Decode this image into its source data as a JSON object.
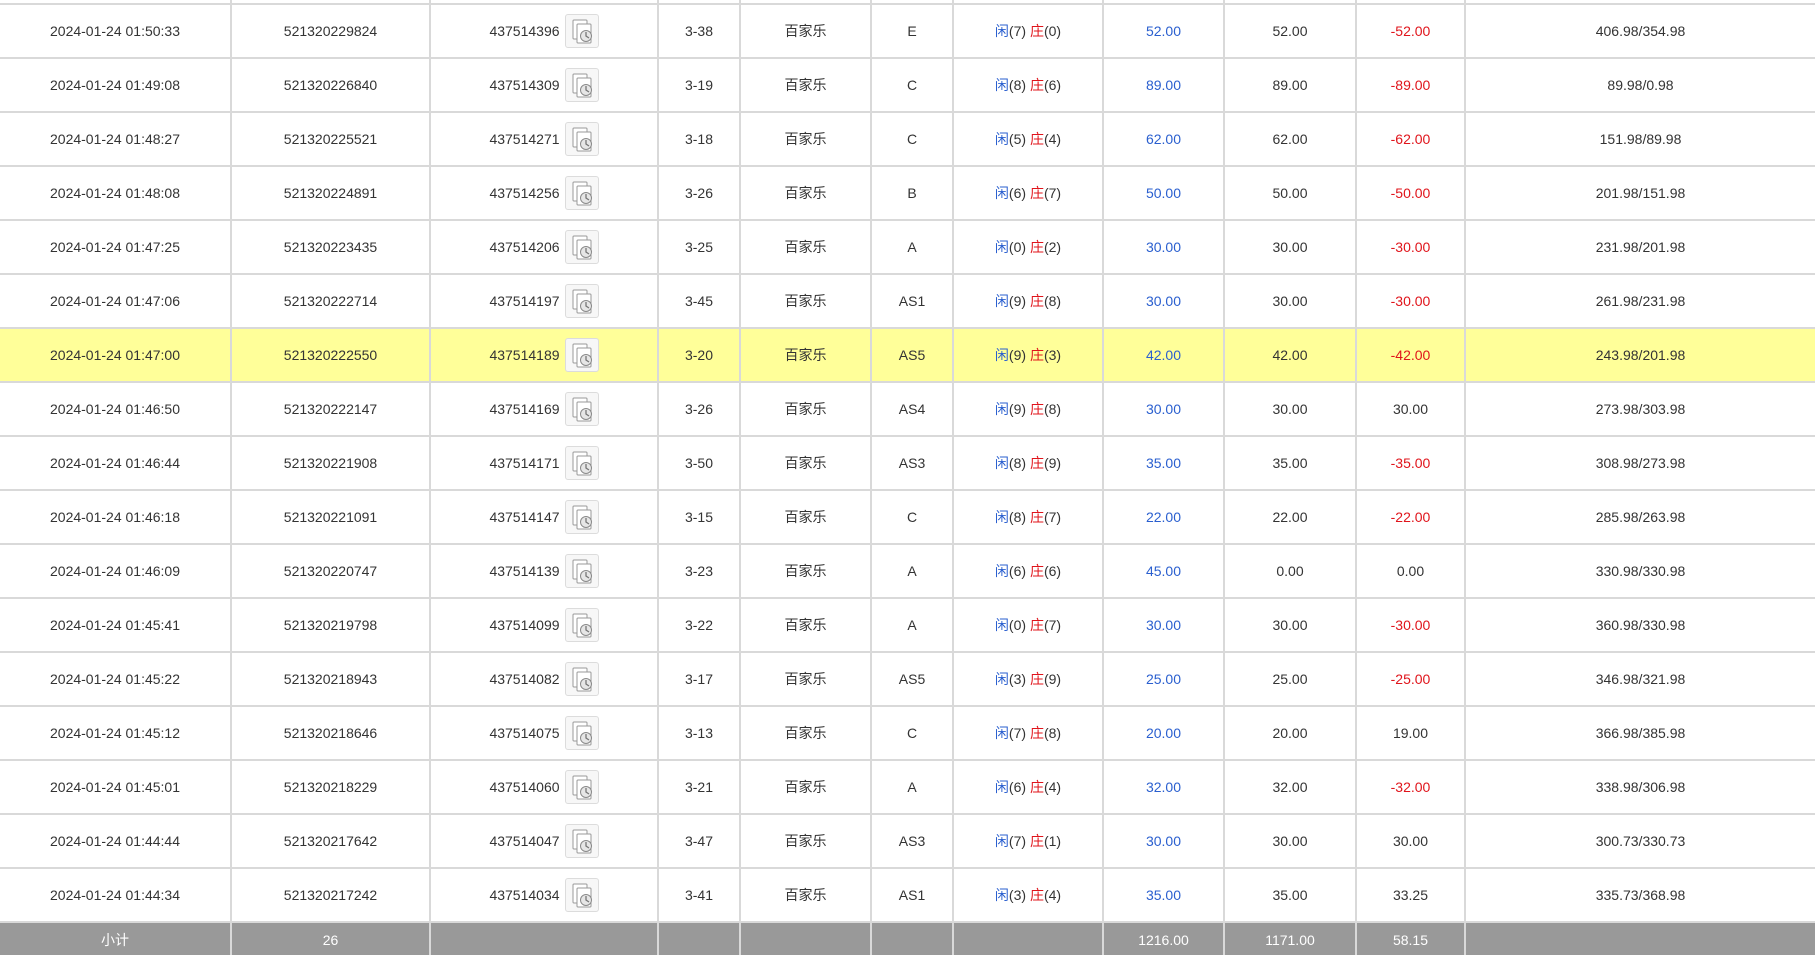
{
  "labels": {
    "player": "闲",
    "banker": "庄"
  },
  "colors": {
    "highlight_row": "#ffff99",
    "bet_amount": "#2a5fcf",
    "negative": "#e0141b",
    "subtotal_bg": "#999999"
  },
  "rows": [
    {
      "time": "2024-01-24 01:50:33",
      "order_id": "521320229824",
      "round_id": "437514396",
      "shoe": "3-38",
      "game": "百家乐",
      "table": "E",
      "player_score": "(7)",
      "banker_score": "(0)",
      "bet": "52.00",
      "valid_bet": "52.00",
      "winloss": "-52.00",
      "balance": "406.98/354.98"
    },
    {
      "time": "2024-01-24 01:49:08",
      "order_id": "521320226840",
      "round_id": "437514309",
      "shoe": "3-19",
      "game": "百家乐",
      "table": "C",
      "player_score": "(8)",
      "banker_score": "(6)",
      "bet": "89.00",
      "valid_bet": "89.00",
      "winloss": "-89.00",
      "balance": "89.98/0.98"
    },
    {
      "time": "2024-01-24 01:48:27",
      "order_id": "521320225521",
      "round_id": "437514271",
      "shoe": "3-18",
      "game": "百家乐",
      "table": "C",
      "player_score": "(5)",
      "banker_score": "(4)",
      "bet": "62.00",
      "valid_bet": "62.00",
      "winloss": "-62.00",
      "balance": "151.98/89.98"
    },
    {
      "time": "2024-01-24 01:48:08",
      "order_id": "521320224891",
      "round_id": "437514256",
      "shoe": "3-26",
      "game": "百家乐",
      "table": "B",
      "player_score": "(6)",
      "banker_score": "(7)",
      "bet": "50.00",
      "valid_bet": "50.00",
      "winloss": "-50.00",
      "balance": "201.98/151.98"
    },
    {
      "time": "2024-01-24 01:47:25",
      "order_id": "521320223435",
      "round_id": "437514206",
      "shoe": "3-25",
      "game": "百家乐",
      "table": "A",
      "player_score": "(0)",
      "banker_score": "(2)",
      "bet": "30.00",
      "valid_bet": "30.00",
      "winloss": "-30.00",
      "balance": "231.98/201.98"
    },
    {
      "time": "2024-01-24 01:47:06",
      "order_id": "521320222714",
      "round_id": "437514197",
      "shoe": "3-45",
      "game": "百家乐",
      "table": "AS1",
      "player_score": "(9)",
      "banker_score": "(8)",
      "bet": "30.00",
      "valid_bet": "30.00",
      "winloss": "-30.00",
      "balance": "261.98/231.98"
    },
    {
      "time": "2024-01-24 01:47:00",
      "order_id": "521320222550",
      "round_id": "437514189",
      "shoe": "3-20",
      "game": "百家乐",
      "table": "AS5",
      "player_score": "(9)",
      "banker_score": "(3)",
      "bet": "42.00",
      "valid_bet": "42.00",
      "winloss": "-42.00",
      "balance": "243.98/201.98",
      "highlight": true
    },
    {
      "time": "2024-01-24 01:46:50",
      "order_id": "521320222147",
      "round_id": "437514169",
      "shoe": "3-26",
      "game": "百家乐",
      "table": "AS4",
      "player_score": "(9)",
      "banker_score": "(8)",
      "bet": "30.00",
      "valid_bet": "30.00",
      "winloss": "30.00",
      "balance": "273.98/303.98"
    },
    {
      "time": "2024-01-24 01:46:44",
      "order_id": "521320221908",
      "round_id": "437514171",
      "shoe": "3-50",
      "game": "百家乐",
      "table": "AS3",
      "player_score": "(8)",
      "banker_score": "(9)",
      "bet": "35.00",
      "valid_bet": "35.00",
      "winloss": "-35.00",
      "balance": "308.98/273.98"
    },
    {
      "time": "2024-01-24 01:46:18",
      "order_id": "521320221091",
      "round_id": "437514147",
      "shoe": "3-15",
      "game": "百家乐",
      "table": "C",
      "player_score": "(8)",
      "banker_score": "(7)",
      "bet": "22.00",
      "valid_bet": "22.00",
      "winloss": "-22.00",
      "balance": "285.98/263.98"
    },
    {
      "time": "2024-01-24 01:46:09",
      "order_id": "521320220747",
      "round_id": "437514139",
      "shoe": "3-23",
      "game": "百家乐",
      "table": "A",
      "player_score": "(6)",
      "banker_score": "(6)",
      "bet": "45.00",
      "valid_bet": "0.00",
      "winloss": "0.00",
      "balance": "330.98/330.98"
    },
    {
      "time": "2024-01-24 01:45:41",
      "order_id": "521320219798",
      "round_id": "437514099",
      "shoe": "3-22",
      "game": "百家乐",
      "table": "A",
      "player_score": "(0)",
      "banker_score": "(7)",
      "bet": "30.00",
      "valid_bet": "30.00",
      "winloss": "-30.00",
      "balance": "360.98/330.98"
    },
    {
      "time": "2024-01-24 01:45:22",
      "order_id": "521320218943",
      "round_id": "437514082",
      "shoe": "3-17",
      "game": "百家乐",
      "table": "AS5",
      "player_score": "(3)",
      "banker_score": "(9)",
      "bet": "25.00",
      "valid_bet": "25.00",
      "winloss": "-25.00",
      "balance": "346.98/321.98"
    },
    {
      "time": "2024-01-24 01:45:12",
      "order_id": "521320218646",
      "round_id": "437514075",
      "shoe": "3-13",
      "game": "百家乐",
      "table": "C",
      "player_score": "(7)",
      "banker_score": "(8)",
      "bet": "20.00",
      "valid_bet": "20.00",
      "winloss": "19.00",
      "balance": "366.98/385.98"
    },
    {
      "time": "2024-01-24 01:45:01",
      "order_id": "521320218229",
      "round_id": "437514060",
      "shoe": "3-21",
      "game": "百家乐",
      "table": "A",
      "player_score": "(6)",
      "banker_score": "(4)",
      "bet": "32.00",
      "valid_bet": "32.00",
      "winloss": "-32.00",
      "balance": "338.98/306.98"
    },
    {
      "time": "2024-01-24 01:44:44",
      "order_id": "521320217642",
      "round_id": "437514047",
      "shoe": "3-47",
      "game": "百家乐",
      "table": "AS3",
      "player_score": "(7)",
      "banker_score": "(1)",
      "bet": "30.00",
      "valid_bet": "30.00",
      "winloss": "30.00",
      "balance": "300.73/330.73"
    },
    {
      "time": "2024-01-24 01:44:34",
      "order_id": "521320217242",
      "round_id": "437514034",
      "shoe": "3-41",
      "game": "百家乐",
      "table": "AS1",
      "player_score": "(3)",
      "banker_score": "(4)",
      "bet": "35.00",
      "valid_bet": "35.00",
      "winloss": "33.25",
      "balance": "335.73/368.98"
    }
  ],
  "subtotal": {
    "label": "小计",
    "count": "26",
    "bet_total": "1216.00",
    "valid_total": "1171.00",
    "winloss_total": "58.15"
  }
}
